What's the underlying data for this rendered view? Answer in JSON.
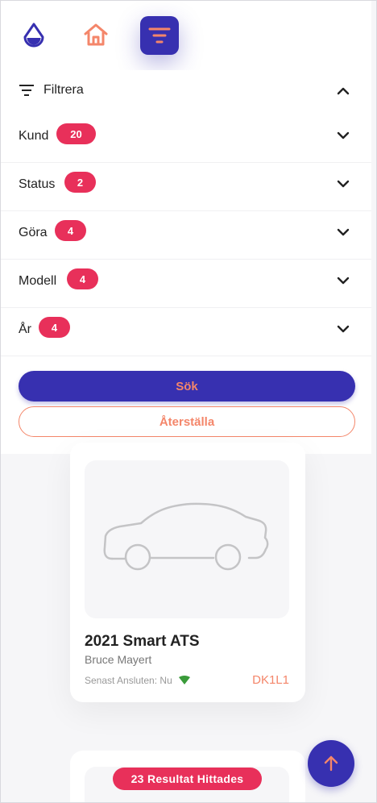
{
  "nav": {
    "items": [
      {
        "icon": "water-drop-icon"
      },
      {
        "icon": "home-icon"
      },
      {
        "icon": "filter-icon",
        "active": true
      }
    ]
  },
  "filter": {
    "header_label": "Filtrera",
    "rows": [
      {
        "label": "Kund",
        "count": "20"
      },
      {
        "label": "Status",
        "count": "2"
      },
      {
        "label": "Göra",
        "count": "4"
      },
      {
        "label": "Modell",
        "count": "4"
      },
      {
        "label": "År",
        "count": "4"
      }
    ],
    "search_label": "Sök",
    "reset_label": "Återställa"
  },
  "vehicle": {
    "title": "2021 Smart ATS",
    "owner": "Bruce Mayert",
    "last_connected": "Senast Ansluten: Nu",
    "code": "DK1L1"
  },
  "results_label": "23 Resultat Hittades",
  "colors": {
    "primary": "#3730b0",
    "accent": "#f4866a",
    "badge": "#e8305a",
    "signal": "#3a9b3a"
  }
}
